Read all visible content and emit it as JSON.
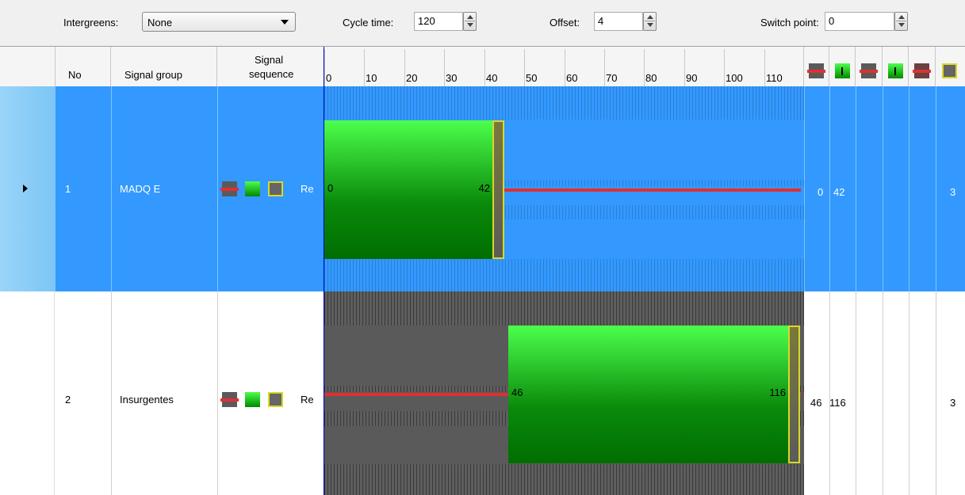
{
  "toolbar": {
    "intergreens_label": "Intergreens:",
    "intergreens_value": "None",
    "cycle_time_label": "Cycle time:",
    "cycle_time_value": "120",
    "offset_label": "Offset:",
    "offset_value": "4",
    "switch_point_label": "Switch point:",
    "switch_point_value": "0"
  },
  "columns": {
    "no": "No",
    "signal_group": "Signal group",
    "signal_sequence_1": "Signal",
    "signal_sequence_2": "sequence"
  },
  "timeline": {
    "ticks": [
      "0",
      "10",
      "20",
      "30",
      "40",
      "50",
      "60",
      "70",
      "80",
      "90",
      "100",
      "110"
    ],
    "cycle": 120
  },
  "rows": [
    {
      "no": "1",
      "signal_group": "MADQ E",
      "sequence_label": "Re",
      "green_start": 0,
      "green_end": 42,
      "amber_end": 45,
      "start_label": "0",
      "end_label": "42",
      "col_red_end": "0",
      "col_green_start": "42",
      "col_last": "3",
      "selected": true
    },
    {
      "no": "2",
      "signal_group": "Insurgentes",
      "sequence_label": "Re",
      "green_start": 46,
      "green_end": 116,
      "amber_end": 119,
      "start_label": "46",
      "end_label": "116",
      "col_red_end": "46",
      "col_green_start": "116",
      "col_last": "3",
      "selected": false
    }
  ],
  "colors": {
    "selection": "#3399ff",
    "green": "#22cc22",
    "red": "#e03030",
    "amber": "#d8d828",
    "hatch_dark": "#555555"
  }
}
